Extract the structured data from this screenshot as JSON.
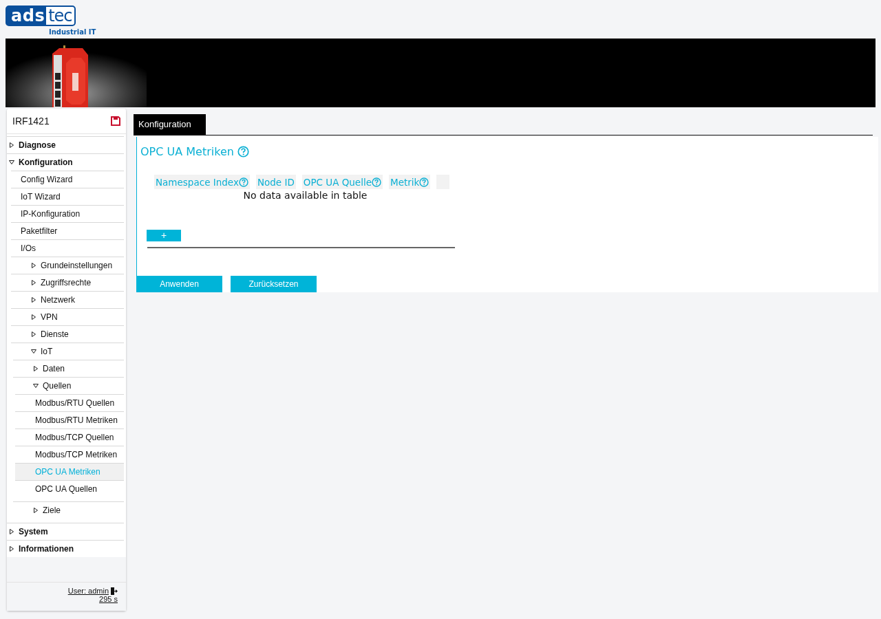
{
  "logo": {
    "brand_left": "ads",
    "brand_right": "tec",
    "tagline": "Industrial IT"
  },
  "sidebar": {
    "device": "IRF1421",
    "nav": [
      {
        "label": "Diagnose",
        "expanded": false,
        "selected": false
      },
      {
        "label": "Konfiguration",
        "expanded": true,
        "selected": false,
        "children": [
          {
            "label": "Config Wizard",
            "selected": false
          },
          {
            "label": "IoT Wizard",
            "selected": false
          },
          {
            "label": "IP-Konfiguration",
            "selected": false
          },
          {
            "label": "Paketfilter",
            "selected": false
          },
          {
            "label": "I/Os",
            "selected": false
          },
          {
            "label": "Grundeinstellungen",
            "expanded": false,
            "selected": false
          },
          {
            "label": "Zugriffsrechte",
            "expanded": false,
            "selected": false
          },
          {
            "label": "Netzwerk",
            "expanded": false,
            "selected": false
          },
          {
            "label": "VPN",
            "expanded": false,
            "selected": false
          },
          {
            "label": "Dienste",
            "expanded": false,
            "selected": false
          },
          {
            "label": "IoT",
            "expanded": true,
            "selected": false,
            "children": [
              {
                "label": "Daten",
                "expanded": false,
                "selected": false
              },
              {
                "label": "Quellen",
                "expanded": true,
                "selected": false,
                "children": [
                  {
                    "label": "Modbus/RTU Quellen",
                    "selected": false
                  },
                  {
                    "label": "Modbus/RTU Metriken",
                    "selected": false
                  },
                  {
                    "label": "Modbus/TCP Quellen",
                    "selected": false
                  },
                  {
                    "label": "Modbus/TCP Metriken",
                    "selected": false
                  },
                  {
                    "label": "OPC UA Metriken",
                    "selected": true
                  },
                  {
                    "label": "OPC UA Quellen",
                    "selected": false
                  }
                ]
              },
              {
                "label": "Ziele",
                "expanded": false,
                "selected": false
              }
            ]
          }
        ]
      },
      {
        "label": "System",
        "expanded": false,
        "selected": false
      },
      {
        "label": "Informationen",
        "expanded": false,
        "selected": false
      }
    ],
    "user": "User: admin",
    "timer": "295 s"
  },
  "tabs": [
    {
      "label": "Konfiguration",
      "selected": true
    }
  ],
  "page": {
    "title": "OPC UA Metriken",
    "table": {
      "columns": [
        {
          "label": "Namespace Index",
          "help": true
        },
        {
          "label": "Node ID",
          "help": false
        },
        {
          "label": "OPC UA Quelle",
          "help": true
        },
        {
          "label": "Metrik",
          "help": true
        }
      ],
      "empty_message": "No data available in table"
    },
    "add_button": "+",
    "buttons": [
      "Anwenden",
      "Zurücksetzen"
    ]
  }
}
